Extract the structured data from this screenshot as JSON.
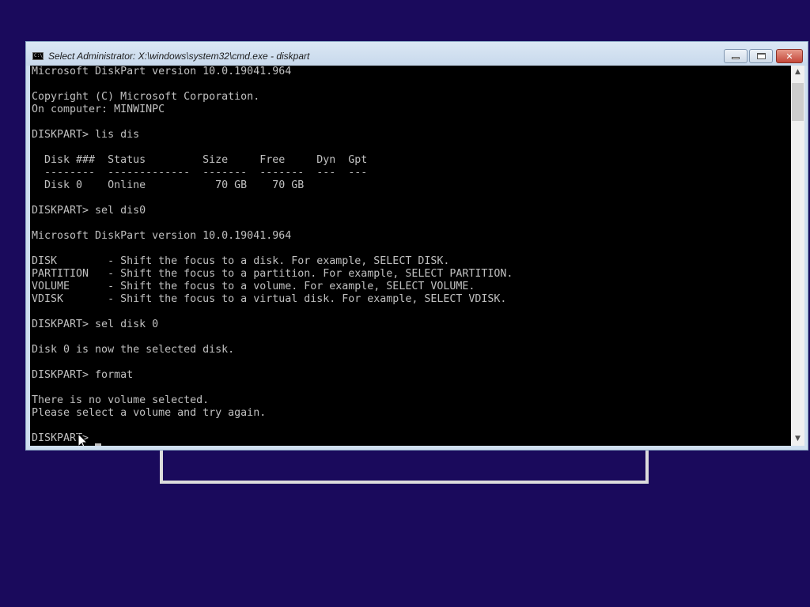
{
  "window": {
    "title": "Select Administrator: X:\\windows\\system32\\cmd.exe - diskpart",
    "icon": "cmd-console-icon",
    "close_glyph": "✕"
  },
  "console": {
    "lines": [
      "Microsoft DiskPart version 10.0.19041.964",
      "",
      "Copyright (C) Microsoft Corporation.",
      "On computer: MINWINPC",
      "",
      "DISKPART> lis dis",
      "",
      "  Disk ###  Status         Size     Free     Dyn  Gpt",
      "  --------  -------------  -------  -------  ---  ---",
      "  Disk 0    Online           70 GB    70 GB",
      "",
      "DISKPART> sel dis0",
      "",
      "Microsoft DiskPart version 10.0.19041.964",
      "",
      "DISK        - Shift the focus to a disk. For example, SELECT DISK.",
      "PARTITION   - Shift the focus to a partition. For example, SELECT PARTITION.",
      "VOLUME      - Shift the focus to a volume. For example, SELECT VOLUME.",
      "VDISK       - Shift the focus to a virtual disk. For example, SELECT VDISK.",
      "",
      "DISKPART> sel disk 0",
      "",
      "Disk 0 is now the selected disk.",
      "",
      "DISKPART> format",
      "",
      "There is no volume selected.",
      "Please select a volume and try again.",
      "",
      "DISKPART> "
    ]
  },
  "colors": {
    "console_bg": "#000000",
    "console_text": "#c0c0c0",
    "desktop_bg": "#1a0a5c"
  }
}
